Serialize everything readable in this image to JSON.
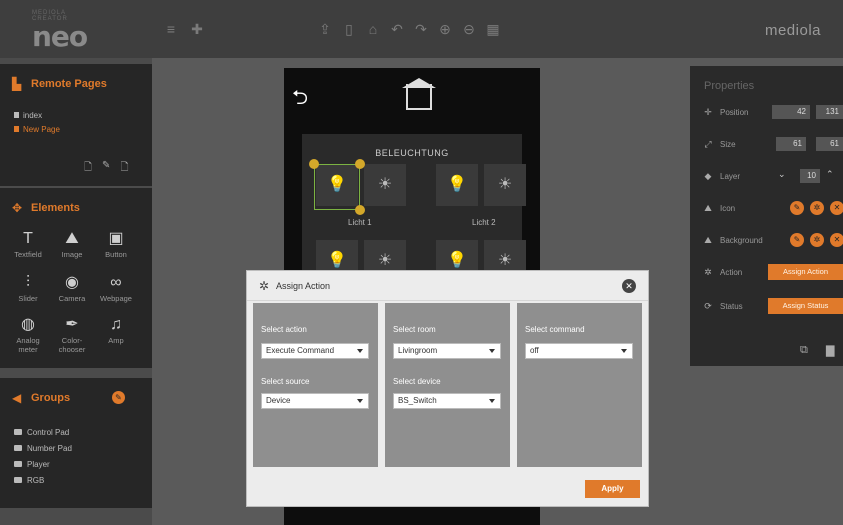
{
  "top_bar": {
    "logo_sub": "MEDIOLA CREATOR",
    "logo_main": "neo",
    "brand": "mediola"
  },
  "remote_pages": {
    "title": "Remote Pages",
    "pages": [
      {
        "label": "index",
        "active": false
      },
      {
        "label": "New Page",
        "active": true
      }
    ]
  },
  "elements": {
    "title": "Elements",
    "items": [
      {
        "label": "Textfield",
        "icon": "textfield-icon"
      },
      {
        "label": "Image",
        "icon": "image-icon"
      },
      {
        "label": "Button",
        "icon": "button-icon"
      },
      {
        "label": "Slider",
        "icon": "slider-icon"
      },
      {
        "label": "Camera",
        "icon": "camera-icon"
      },
      {
        "label": "Webpage",
        "icon": "webpage-icon"
      },
      {
        "label": "Analog meter",
        "icon": "analog-meter-icon"
      },
      {
        "label": "Color- chooser",
        "icon": "color-chooser-icon"
      },
      {
        "label": "Amp",
        "icon": "amp-icon"
      }
    ]
  },
  "groups": {
    "title": "Groups",
    "items": [
      "Control Pad",
      "Number Pad",
      "Player",
      "RGB"
    ]
  },
  "canvas": {
    "section_title": "BELEUCHTUNG",
    "tile_labels": [
      "Licht 1",
      "Licht 2"
    ]
  },
  "properties": {
    "title": "Properties",
    "position_label": "Position",
    "position_x": "42",
    "position_y": "131",
    "size_label": "Size",
    "size_w": "61",
    "size_h": "61",
    "layer_label": "Layer",
    "layer_value": "10",
    "icon_label": "Icon",
    "background_label": "Background",
    "action_label": "Action",
    "action_button": "Assign Action",
    "status_label": "Status",
    "status_button": "Assign Status"
  },
  "dialog": {
    "title": "Assign Action",
    "select_action_label": "Select action",
    "select_action_value": "Execute Command",
    "select_source_label": "Select source",
    "select_source_value": "Device",
    "select_room_label": "Select room",
    "select_room_value": "Livingroom",
    "select_device_label": "Select device",
    "select_device_value": "BS_Switch",
    "select_command_label": "Select command",
    "select_command_value": "off",
    "apply_label": "Apply"
  },
  "colors": {
    "accent": "#e07a2b",
    "selection": "#7cb342",
    "handle": "#d4a82a"
  }
}
